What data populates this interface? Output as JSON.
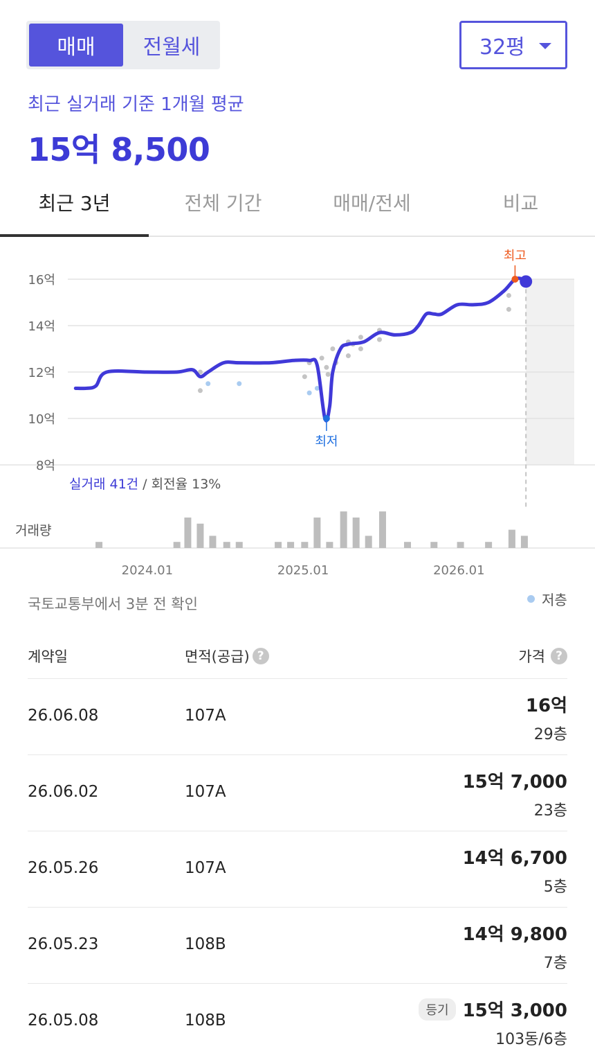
{
  "trade_toggle": {
    "sale_label": "매매",
    "rent_label": "전월세"
  },
  "size_select": {
    "value": "32평"
  },
  "summary": {
    "label": "최근 실거래 기준 1개월 평균",
    "price": "15억 8,500"
  },
  "tabs": [
    {
      "label": "최근 3년",
      "active": true
    },
    {
      "label": "전체 기간",
      "active": false
    },
    {
      "label": "매매/전세",
      "active": false
    },
    {
      "label": "비교",
      "active": false
    }
  ],
  "chart_stats": {
    "count": "실거래 41건",
    "sep": " / ",
    "turnover": "회전율 13%"
  },
  "source_text": "국토교통부에서 3분 전 확인",
  "legend": {
    "low_floor": "저층"
  },
  "table": {
    "headers": {
      "date": "계약일",
      "area": "면적(공급)",
      "price": "가격"
    },
    "rows": [
      {
        "date": "26.06.08",
        "area": "107A",
        "price": "16억",
        "floor": "29층",
        "badge": ""
      },
      {
        "date": "26.06.02",
        "area": "107A",
        "price": "15억 7,000",
        "floor": "23층",
        "badge": ""
      },
      {
        "date": "26.05.26",
        "area": "107A",
        "price": "14억 6,700",
        "floor": "5층",
        "badge": ""
      },
      {
        "date": "26.05.23",
        "area": "108B",
        "price": "14억 9,800",
        "floor": "7층",
        "badge": ""
      },
      {
        "date": "26.05.08",
        "area": "108B",
        "price": "15억 3,000",
        "floor": "103동/6층",
        "badge": "등기"
      }
    ]
  },
  "chart_data": {
    "type": "line",
    "y_unit_labels": [
      "8억",
      "10억",
      "12억",
      "14억",
      "16억"
    ],
    "ylim": [
      8,
      16
    ],
    "x_tick_labels": [
      "2024.01",
      "2025.01",
      "2026.01"
    ],
    "xlim": [
      "2023.07",
      "2026.09"
    ],
    "volume_label": "거래량",
    "high_label": "최고",
    "low_label": "최저",
    "colors": {
      "line": "#4039d8",
      "high": "#ee5a1e",
      "low": "#1f6fe0",
      "scatter": "#c4c4c4",
      "low_floor": "#a9cbf0",
      "volume": "#bdbdbd"
    },
    "line": {
      "x": [
        2023.55,
        2023.62,
        2023.68,
        2023.75,
        2024.0,
        2024.2,
        2024.3,
        2024.35,
        2024.4,
        2024.5,
        2024.6,
        2024.8,
        2024.95,
        2025.05,
        2025.1,
        2025.15,
        2025.18,
        2025.2,
        2025.25,
        2025.3,
        2025.4,
        2025.5,
        2025.6,
        2025.7,
        2025.75,
        2025.8,
        2025.85,
        2025.9,
        2026.0,
        2026.1,
        2026.2,
        2026.3,
        2026.37,
        2026.42,
        2026.44
      ],
      "y": [
        11.3,
        11.3,
        11.4,
        12.0,
        12.0,
        12.0,
        12.1,
        11.8,
        12.0,
        12.4,
        12.4,
        12.4,
        12.5,
        12.5,
        12.3,
        10.0,
        10.5,
        12.0,
        13.0,
        13.2,
        13.3,
        13.7,
        13.6,
        13.7,
        14.0,
        14.5,
        14.5,
        14.5,
        14.9,
        14.9,
        15.0,
        15.5,
        16.0,
        16.0,
        15.9
      ]
    },
    "scatter": {
      "x": [
        2024.35,
        2024.35,
        2025.02,
        2025.05,
        2025.13,
        2025.16,
        2025.17,
        2025.2,
        2025.22,
        2025.3,
        2025.3,
        2025.33,
        2025.38,
        2025.38,
        2025.5,
        2025.5,
        2026.33,
        2026.33
      ],
      "y": [
        12.0,
        11.2,
        11.8,
        12.4,
        12.6,
        12.2,
        11.9,
        13.0,
        12.4,
        13.3,
        12.7,
        13.2,
        13.5,
        13.0,
        13.8,
        13.4,
        15.3,
        14.7
      ]
    },
    "scatter_low_floor": {
      "x": [
        2024.4,
        2024.6,
        2025.05,
        2025.1
      ],
      "y": [
        11.5,
        11.5,
        11.1,
        11.3
      ]
    },
    "high_point": {
      "x": 2026.37,
      "y": 16.0
    },
    "low_point": {
      "x": 2025.16,
      "y": 10.0
    },
    "current_point": {
      "x": 2026.44,
      "y": 15.9
    },
    "volume": {
      "x": [
        2023.7,
        2024.2,
        2024.27,
        2024.35,
        2024.43,
        2024.52,
        2024.6,
        2024.85,
        2024.93,
        2025.02,
        2025.1,
        2025.18,
        2025.27,
        2025.35,
        2025.43,
        2025.52,
        2025.68,
        2025.85,
        2026.02,
        2026.2,
        2026.35,
        2026.43
      ],
      "values": [
        1,
        1,
        5,
        4,
        2,
        1,
        1,
        1,
        1,
        1,
        5,
        1,
        6,
        5,
        2,
        6,
        1,
        1,
        1,
        1,
        3,
        2
      ]
    }
  }
}
